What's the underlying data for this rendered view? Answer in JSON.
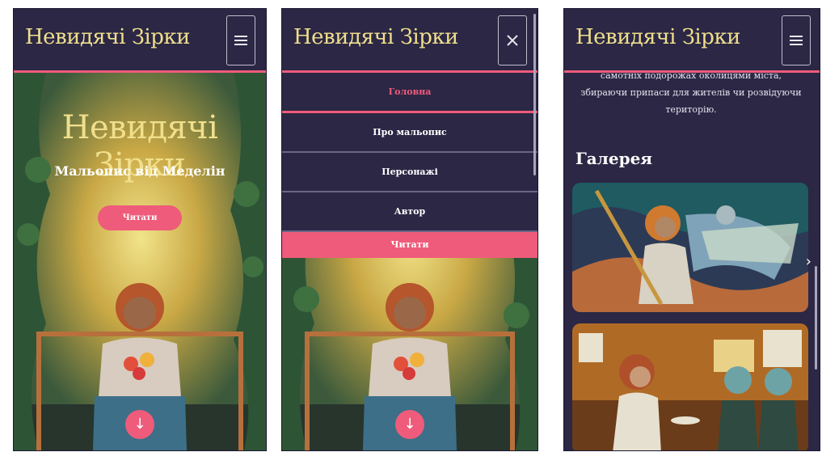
{
  "site": {
    "logo": "Невидячі Зірки"
  },
  "hero": {
    "title": "Невидячі Зірки",
    "subtitle": "Мальопис від Меделін",
    "read_label": "Читати",
    "scroll_down": "↓"
  },
  "menu": {
    "items": [
      {
        "label": "Головна"
      },
      {
        "label": "Про мальопис"
      },
      {
        "label": "Персонажі"
      },
      {
        "label": "Автор"
      },
      {
        "label": "Читати"
      }
    ]
  },
  "about": {
    "text": "самотніх подорожах околицями міста, збираючи припаси для жителів чи розвідуючи територію."
  },
  "gallery": {
    "title": "Галерея",
    "next_icon": "›"
  },
  "colors": {
    "background": "#2b2745",
    "accent": "#ef5b7b",
    "logo": "#f0df8c"
  },
  "icons": {
    "hamburger": "hamburger-icon",
    "close": "close-icon",
    "arrow_down": "arrow-down-icon",
    "chevron_right": "chevron-right-icon"
  }
}
